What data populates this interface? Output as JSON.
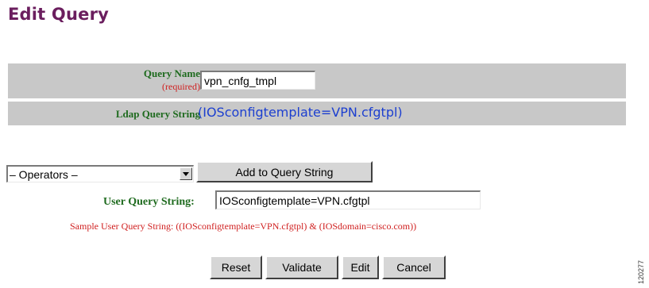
{
  "page": {
    "title": "Edit Query"
  },
  "form": {
    "query_name_label": "Query Name",
    "required_label": "(required)",
    "query_name_value": "vpn_cnfg_tmpl",
    "ldap_label": "Ldap Query String",
    "ldap_value": "(IOSconfigtemplate=VPN.cfgtpl)"
  },
  "operators": {
    "selected": "– Operators –",
    "add_button": "Add to Query String"
  },
  "user_query": {
    "label": "User Query String:",
    "value": "IOSconfigtemplate=VPN.cfgtpl",
    "sample": "Sample User Query String: ((IOSconfigtemplate=VPN.cfgtpl) & (IOSdomain=cisco.com))"
  },
  "buttons": {
    "reset": "Reset",
    "validate": "Validate",
    "edit": "Edit",
    "cancel": "Cancel"
  },
  "figure_id": "120277",
  "colors": {
    "title": "#6b1e5e",
    "label_green": "#1f6b1f",
    "required_red": "#d02020",
    "ldap_blue": "#1c3fd0",
    "row_grey": "#c8c8c8"
  }
}
